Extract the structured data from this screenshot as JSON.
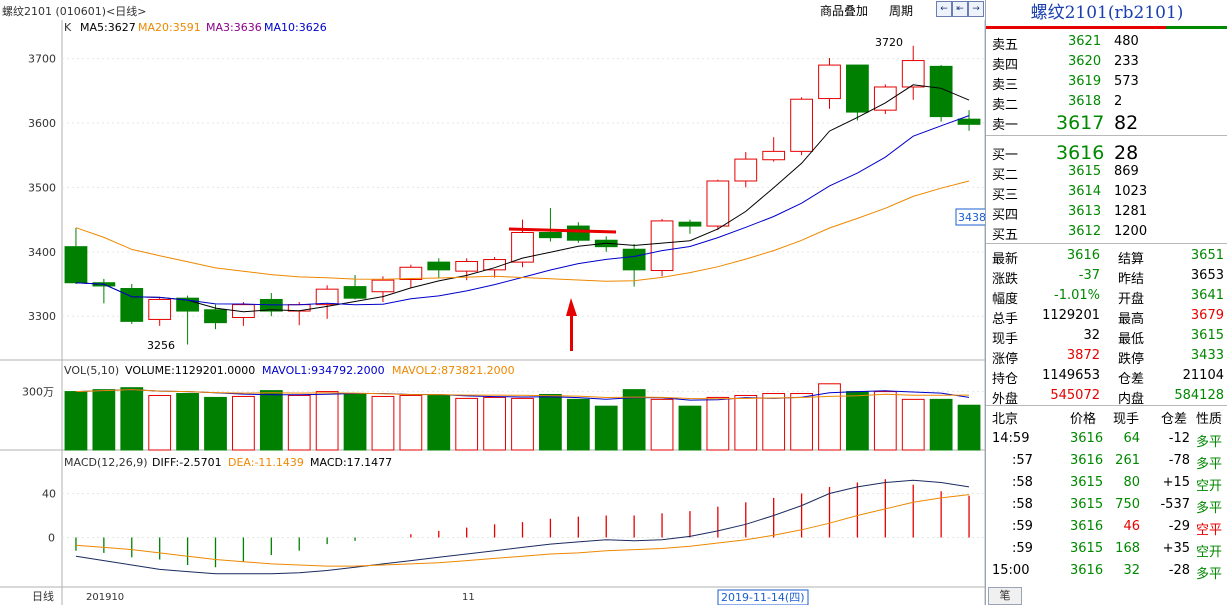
{
  "window": {
    "title": "螺纹2101 (010601)<日线>"
  },
  "toolbar": {
    "overlay_label": "商品叠加",
    "period_label": "周期",
    "nav_icons": [
      "←",
      "⇤",
      "→"
    ]
  },
  "indicators": {
    "k_label": "K",
    "ma5": "MA5:3627",
    "ma20": "MA20:3591",
    "ma3": "MA3:3636",
    "ma10": "MA10:3626",
    "vol_header": "VOL(5,10)",
    "volume": "VOLUME:1129201.0000",
    "mavol1": "MAVOL1:934792.2000",
    "mavol2": "MAVOL2:873821.2000",
    "macd_header": "MACD(12,26,9)",
    "diff": "DIFF:-2.5701",
    "dea": "DEA:-11.1439",
    "macd": "MACD:17.1477"
  },
  "annotations": {
    "high_label": "3720",
    "low_label": "3256",
    "price_marker": "3438"
  },
  "x_axis": {
    "period_label": "日线",
    "labels": [
      "201910",
      "11"
    ],
    "cursor_date": "2019-11-14(四)"
  },
  "colors": {
    "up": "#e60000",
    "down": "#008000",
    "ma5": "#000000",
    "ma20": "#ee8800",
    "ma3": "#8b008b",
    "ma10": "#0000cc",
    "accent": "#1a3fb0"
  },
  "chart_data": {
    "type": "candlestick",
    "price_axis": {
      "ticks": [
        3300,
        3400,
        3500,
        3600,
        3700
      ],
      "range": [
        3232,
        3760
      ]
    },
    "volume_axis": {
      "ticks": [
        "300万"
      ],
      "unit": "万"
    },
    "macd_axis": {
      "ticks": [
        40,
        0
      ]
    },
    "candles": [
      {
        "o": 3408,
        "c": 3352,
        "h": 3437,
        "l": 3350
      },
      {
        "o": 3352,
        "c": 3347,
        "h": 3358,
        "l": 3320
      },
      {
        "o": 3343,
        "c": 3292,
        "h": 3350,
        "l": 3288
      },
      {
        "o": 3295,
        "c": 3326,
        "h": 3330,
        "l": 3285
      },
      {
        "o": 3328,
        "c": 3308,
        "h": 3332,
        "l": 3256
      },
      {
        "o": 3310,
        "c": 3290,
        "h": 3318,
        "l": 3280
      },
      {
        "o": 3298,
        "c": 3318,
        "h": 3322,
        "l": 3285
      },
      {
        "o": 3326,
        "c": 3308,
        "h": 3336,
        "l": 3300
      },
      {
        "o": 3308,
        "c": 3318,
        "h": 3322,
        "l": 3286
      },
      {
        "o": 3318,
        "c": 3342,
        "h": 3348,
        "l": 3296
      },
      {
        "o": 3346,
        "c": 3328,
        "h": 3364,
        "l": 3326
      },
      {
        "o": 3338,
        "c": 3356,
        "h": 3362,
        "l": 3322
      },
      {
        "o": 3357,
        "c": 3376,
        "h": 3380,
        "l": 3344
      },
      {
        "o": 3384,
        "c": 3372,
        "h": 3390,
        "l": 3360
      },
      {
        "o": 3370,
        "c": 3385,
        "h": 3390,
        "l": 3356
      },
      {
        "o": 3372,
        "c": 3388,
        "h": 3392,
        "l": 3360
      },
      {
        "o": 3384,
        "c": 3430,
        "h": 3450,
        "l": 3376
      },
      {
        "o": 3430,
        "c": 3422,
        "h": 3468,
        "l": 3416
      },
      {
        "o": 3440,
        "c": 3418,
        "h": 3446,
        "l": 3414
      },
      {
        "o": 3418,
        "c": 3408,
        "h": 3424,
        "l": 3400
      },
      {
        "o": 3404,
        "c": 3372,
        "h": 3412,
        "l": 3346
      },
      {
        "o": 3371,
        "c": 3448,
        "h": 3451,
        "l": 3362
      },
      {
        "o": 3446,
        "c": 3440,
        "h": 3450,
        "l": 3428
      },
      {
        "o": 3440,
        "c": 3510,
        "h": 3512,
        "l": 3434
      },
      {
        "o": 3510,
        "c": 3544,
        "h": 3555,
        "l": 3500
      },
      {
        "o": 3543,
        "c": 3556,
        "h": 3578,
        "l": 3540
      },
      {
        "o": 3556,
        "c": 3637,
        "h": 3640,
        "l": 3550
      },
      {
        "o": 3638,
        "c": 3690,
        "h": 3701,
        "l": 3622
      },
      {
        "o": 3690,
        "c": 3617,
        "h": 3690,
        "l": 3604
      },
      {
        "o": 3620,
        "c": 3656,
        "h": 3660,
        "l": 3614
      },
      {
        "o": 3656,
        "c": 3697,
        "h": 3720,
        "l": 3636
      },
      {
        "o": 3688,
        "c": 3610,
        "h": 3690,
        "l": 3602
      },
      {
        "o": 3606,
        "c": 3598,
        "h": 3620,
        "l": 3588
      }
    ],
    "volumes": [
      300,
      310,
      320,
      280,
      290,
      270,
      275,
      305,
      280,
      300,
      290,
      275,
      280,
      280,
      265,
      270,
      265,
      285,
      260,
      225,
      310,
      260,
      225,
      270,
      280,
      290,
      290,
      340,
      300,
      300,
      260,
      260,
      230,
      215
    ],
    "macd_bars": [
      -12,
      -14,
      -18,
      -20,
      -25,
      -27,
      -22,
      -16,
      -12,
      -6,
      -3,
      0,
      3,
      6,
      9,
      12,
      14,
      17,
      19,
      20,
      20,
      22,
      24,
      28,
      32,
      36,
      40,
      46,
      50,
      53,
      48,
      42,
      38,
      30
    ],
    "diff_line": [
      -17,
      -21,
      -25,
      -29,
      -31,
      -33,
      -33,
      -33,
      -32,
      -30,
      -27,
      -24,
      -21,
      -18,
      -15,
      -12,
      -9,
      -6,
      -4,
      -2,
      -3,
      -2,
      1,
      6,
      12,
      20,
      29,
      40,
      46,
      50,
      52,
      50,
      46
    ],
    "dea_line": [
      -7,
      -9,
      -11,
      -14,
      -17,
      -20,
      -22,
      -24,
      -25,
      -26,
      -26,
      -25,
      -24,
      -23,
      -21,
      -19,
      -17,
      -15,
      -14,
      -12,
      -11,
      -10,
      -8,
      -5,
      -2,
      2,
      7,
      13,
      20,
      26,
      32,
      36,
      39
    ]
  },
  "quote": {
    "name": "螺纹2101(rb2101)",
    "asks": [
      {
        "label": "卖五",
        "price": "3621",
        "vol": "480"
      },
      {
        "label": "卖四",
        "price": "3620",
        "vol": "233"
      },
      {
        "label": "卖三",
        "price": "3619",
        "vol": "573"
      },
      {
        "label": "卖二",
        "price": "3618",
        "vol": "2"
      },
      {
        "label": "卖一",
        "price": "3617",
        "vol": "82"
      }
    ],
    "bids": [
      {
        "label": "买一",
        "price": "3616",
        "vol": "28"
      },
      {
        "label": "买二",
        "price": "3615",
        "vol": "869"
      },
      {
        "label": "买三",
        "price": "3614",
        "vol": "1023"
      },
      {
        "label": "买四",
        "price": "3613",
        "vol": "1281"
      },
      {
        "label": "买五",
        "price": "3612",
        "vol": "1200"
      }
    ],
    "stats": [
      {
        "l1": "最新",
        "v1": "3616",
        "c1": "green",
        "l2": "结算",
        "v2": "3651",
        "c2": "green"
      },
      {
        "l1": "涨跌",
        "v1": "-37",
        "c1": "green",
        "l2": "昨结",
        "v2": "3653",
        "c2": "blk"
      },
      {
        "l1": "幅度",
        "v1": "-1.01%",
        "c1": "green",
        "l2": "开盘",
        "v2": "3641",
        "c2": "green"
      },
      {
        "l1": "总手",
        "v1": "1129201",
        "c1": "blk",
        "l2": "最高",
        "v2": "3679",
        "c2": "red"
      },
      {
        "l1": "现手",
        "v1": "32",
        "c1": "blk",
        "l2": "最低",
        "v2": "3615",
        "c2": "green"
      },
      {
        "l1": "涨停",
        "v1": "3872",
        "c1": "red",
        "l2": "跌停",
        "v2": "3433",
        "c2": "green"
      },
      {
        "l1": "持仓",
        "v1": "1149653",
        "c1": "blk",
        "l2": "仓差",
        "v2": "21104",
        "c2": "blk"
      },
      {
        "l1": "外盘",
        "v1": "545072",
        "c1": "red",
        "l2": "内盘",
        "v2": "584128",
        "c2": "green"
      }
    ],
    "ticks_header": {
      "place": "北京",
      "price": "价格",
      "vol": "现手",
      "oi": "仓差",
      "nature": "性质"
    },
    "ticks": [
      {
        "time": "14:59",
        "price": "3616",
        "vol": "64",
        "oi": "-12",
        "nature": "多平",
        "vc": "green",
        "nc": "green"
      },
      {
        "time": ":57",
        "price": "3616",
        "vol": "261",
        "oi": "-78",
        "nature": "多平",
        "vc": "green",
        "nc": "green"
      },
      {
        "time": ":58",
        "price": "3615",
        "vol": "80",
        "oi": "+15",
        "nature": "空开",
        "vc": "green",
        "nc": "green"
      },
      {
        "time": ":58",
        "price": "3615",
        "vol": "750",
        "oi": "-537",
        "nature": "多平",
        "vc": "green",
        "nc": "green"
      },
      {
        "time": ":59",
        "price": "3616",
        "vol": "46",
        "oi": "-29",
        "nature": "空平",
        "vc": "red",
        "nc": "red"
      },
      {
        "time": ":59",
        "price": "3615",
        "vol": "168",
        "oi": "+35",
        "nature": "空开",
        "vc": "green",
        "nc": "green"
      },
      {
        "time": "15:00",
        "price": "3616",
        "vol": "32",
        "oi": "-28",
        "nature": "多平",
        "vc": "green",
        "nc": "green"
      }
    ],
    "footer_tab": "笔"
  }
}
